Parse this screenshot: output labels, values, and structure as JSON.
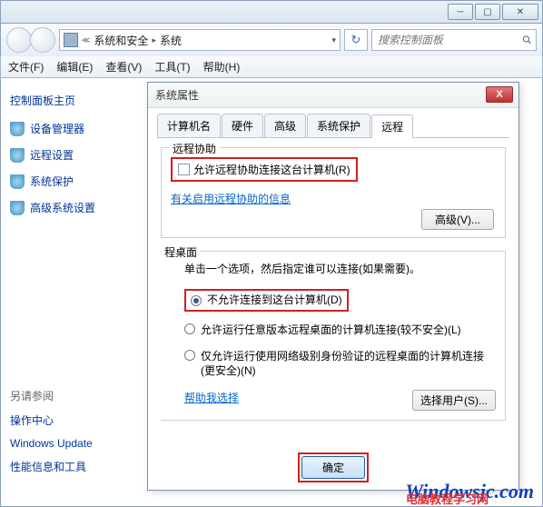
{
  "window": {
    "breadcrumb": {
      "part1": "系统和安全",
      "part2": "系统"
    },
    "search_placeholder": "搜索控制面板"
  },
  "menu": {
    "file": "文件(F)",
    "edit": "编辑(E)",
    "view": "查看(V)",
    "tools": "工具(T)",
    "help": "帮助(H)"
  },
  "sidebar": {
    "title": "控制面板主页",
    "items": [
      {
        "label": "设备管理器"
      },
      {
        "label": "远程设置"
      },
      {
        "label": "系统保护"
      },
      {
        "label": "高级系统设置"
      }
    ],
    "see_also_title": "另请参阅",
    "see_also": [
      {
        "label": "操作中心"
      },
      {
        "label": "Windows Update"
      },
      {
        "label": "性能信息和工具"
      }
    ]
  },
  "dialog": {
    "title": "系统属性",
    "tabs": {
      "computer_name": "计算机名",
      "hardware": "硬件",
      "advanced": "高级",
      "system_protection": "系统保护",
      "remote": "远程"
    },
    "remote_assist": {
      "legend": "远程协助",
      "checkbox_label": "允许远程协助连接这台计算机(R)",
      "help_link": "有关启用远程协助的信息",
      "advanced_btn": "高级(V)..."
    },
    "remote_desktop": {
      "legend": "程桌面",
      "note": "单击一个选项，然后指定谁可以连接(如果需要)。",
      "opt1": "不允许连接到这台计算机(D)",
      "opt2": "允许运行任意版本远程桌面的计算机连接(较不安全)(L)",
      "opt3": "仅允许运行使用网络级别身份验证的远程桌面的计算机连接(更安全)(N)",
      "help_link": "帮助我选择",
      "select_user_btn": "选择用户(S)..."
    },
    "ok_btn": "确定"
  },
  "watermark": {
    "w1": "Windowsjc.com",
    "w2": "电脑教程学习网"
  }
}
